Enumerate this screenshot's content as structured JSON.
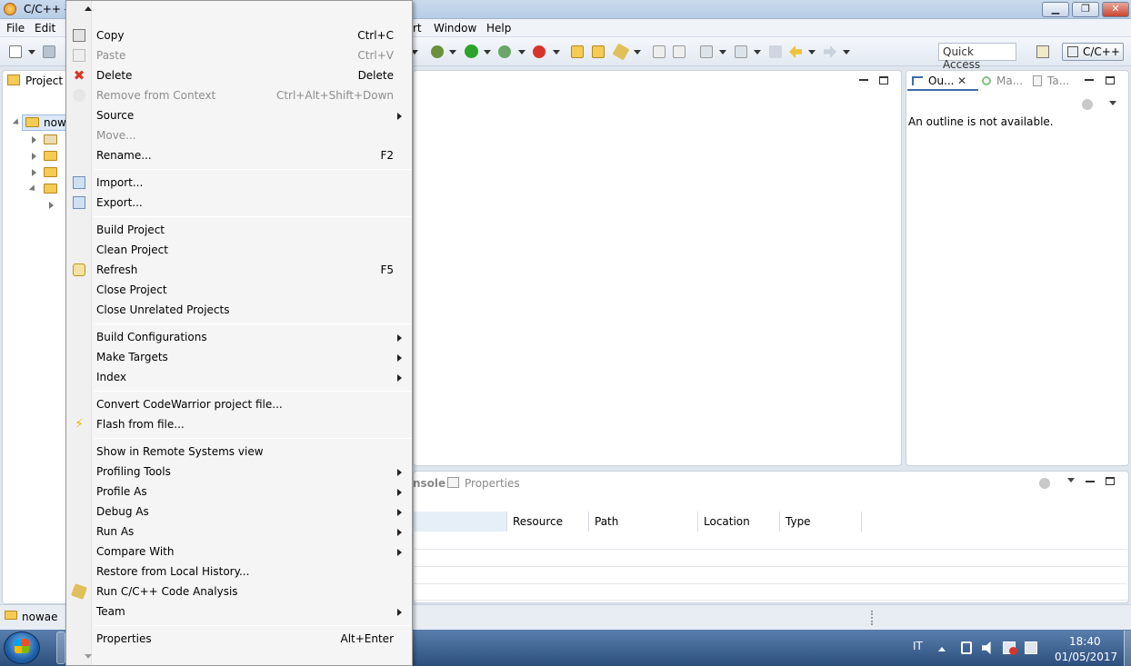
{
  "window": {
    "title": "C/C++ -",
    "controls": {
      "minimize": "▁",
      "maximize": "❐",
      "close": "✕"
    }
  },
  "menubar": {
    "items": [
      "File",
      "Edit",
      "rt",
      "Window",
      "Help"
    ]
  },
  "toolbar": {
    "quick_access": "Quick Access",
    "perspective": "C/C++"
  },
  "left_panel": {
    "tab_title": "Project E",
    "root_item": "now",
    "status_item": "nowae"
  },
  "outline": {
    "tabs": [
      "Ou...",
      "Ma...",
      "Ta..."
    ],
    "message": "An outline is not available."
  },
  "bottom": {
    "tabs": [
      "nsole",
      "Properties"
    ],
    "columns": [
      "Resource",
      "Path",
      "Location",
      "Type"
    ]
  },
  "context_menu": {
    "items": [
      {
        "label": "Copy",
        "shortcut": "Ctrl+C",
        "icon": "copy-icon",
        "disabled": false
      },
      {
        "label": "Paste",
        "shortcut": "Ctrl+V",
        "icon": "paste-icon",
        "disabled": true
      },
      {
        "label": "Delete",
        "shortcut": "Delete",
        "icon": "delete-icon",
        "disabled": false
      },
      {
        "label": "Remove from Context",
        "shortcut": "Ctrl+Alt+Shift+Down",
        "icon": "remove-context-icon",
        "disabled": true
      },
      {
        "label": "Source",
        "submenu": true
      },
      {
        "label": "Move...",
        "disabled": true
      },
      {
        "label": "Rename...",
        "shortcut": "F2"
      },
      {
        "label": "Import...",
        "icon": "import-icon"
      },
      {
        "label": "Export...",
        "icon": "export-icon"
      },
      {
        "label": "Build Project"
      },
      {
        "label": "Clean Project"
      },
      {
        "label": "Refresh",
        "shortcut": "F5",
        "icon": "refresh-icon"
      },
      {
        "label": "Close Project"
      },
      {
        "label": "Close Unrelated Projects"
      },
      {
        "label": "Build Configurations",
        "submenu": true
      },
      {
        "label": "Make Targets",
        "submenu": true
      },
      {
        "label": "Index",
        "submenu": true
      },
      {
        "label": "Convert CodeWarrior project file..."
      },
      {
        "label": "Flash from file...",
        "icon": "flash-icon"
      },
      {
        "label": "Show in Remote Systems view"
      },
      {
        "label": "Profiling Tools",
        "submenu": true
      },
      {
        "label": "Profile As",
        "submenu": true
      },
      {
        "label": "Debug As",
        "submenu": true
      },
      {
        "label": "Run As",
        "submenu": true
      },
      {
        "label": "Compare With",
        "submenu": true
      },
      {
        "label": "Restore from Local History..."
      },
      {
        "label": "Run C/C++ Code Analysis",
        "icon": "code-analysis-icon"
      },
      {
        "label": "Team",
        "submenu": true
      },
      {
        "label": "Properties",
        "shortcut": "Alt+Enter"
      }
    ]
  },
  "taskbar": {
    "language": "IT",
    "time": "18:40",
    "date": "01/05/2017"
  },
  "colors": {
    "accent": "#3b6ea8",
    "delete_red": "#d9342b",
    "run_green": "#2aa52a"
  }
}
